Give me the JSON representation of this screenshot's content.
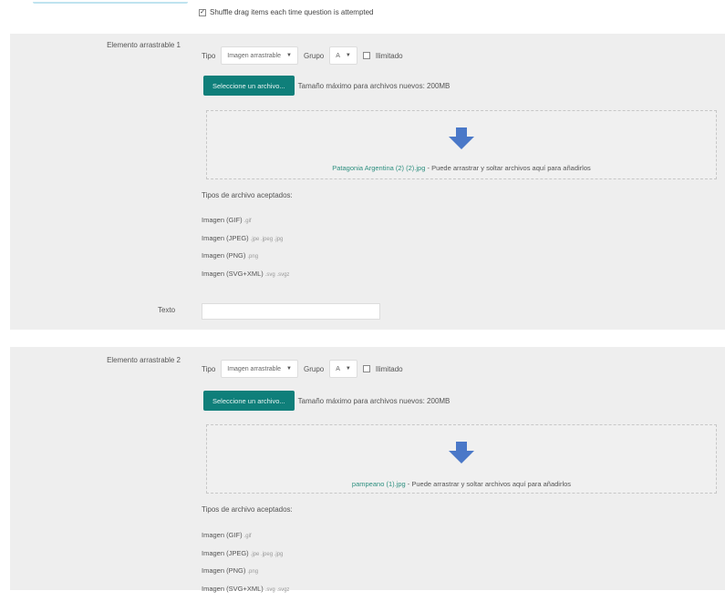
{
  "shuffle": {
    "checked": true,
    "label": "Shuffle drag items each time question is attempted"
  },
  "items": [
    {
      "label": "Elemento arrastrable 1",
      "tipo_label": "Tipo",
      "tipo_value": "Imagen arrastrable",
      "grupo_label": "Grupo",
      "grupo_value": "A",
      "ilimitado_label": "Ilimitado",
      "file_button": "Seleccione un archivo...",
      "max_size": "Tamaño máximo para archivos nuevos: 200MB",
      "file_name": "Patagonia Argentina (2) (2).jpg",
      "drop_hint": " - Puede arrastrar y soltar archivos aquí para añadirlos",
      "types_title": "Tipos de archivo aceptados:",
      "types": [
        {
          "name": "Imagen (GIF)",
          "ext": ".gif"
        },
        {
          "name": "Imagen (JPEG)",
          "ext": ".jpe .jpeg .jpg"
        },
        {
          "name": "Imagen (PNG)",
          "ext": ".png"
        },
        {
          "name": "Imagen (SVG+XML)",
          "ext": ".svg .svgz"
        }
      ],
      "text_label": "Texto",
      "text_value": ""
    },
    {
      "label": "Elemento arrastrable 2",
      "tipo_label": "Tipo",
      "tipo_value": "Imagen arrastrable",
      "grupo_label": "Grupo",
      "grupo_value": "A",
      "ilimitado_label": "Ilimitado",
      "file_button": "Seleccione un archivo...",
      "max_size": "Tamaño máximo para archivos nuevos: 200MB",
      "file_name": "pampeano (1).jpg",
      "drop_hint": " - Puede arrastrar y soltar archivos aquí para añadirlos",
      "types_title": "Tipos de archivo aceptados:",
      "types": [
        {
          "name": "Imagen (GIF)",
          "ext": ".gif"
        },
        {
          "name": "Imagen (JPEG)",
          "ext": ".jpe .jpeg .jpg"
        },
        {
          "name": "Imagen (PNG)",
          "ext": ".png"
        },
        {
          "name": "Imagen (SVG+XML)",
          "ext": ".svg .svgz"
        }
      ]
    }
  ],
  "icons": {
    "drop": "arrow-down-icon",
    "select": "chevron-down-icon"
  },
  "colors": {
    "button": "#0f7f7a",
    "panel": "#eeeeee",
    "filename": "#2d8f7f",
    "arrow": "#4a78c8"
  }
}
